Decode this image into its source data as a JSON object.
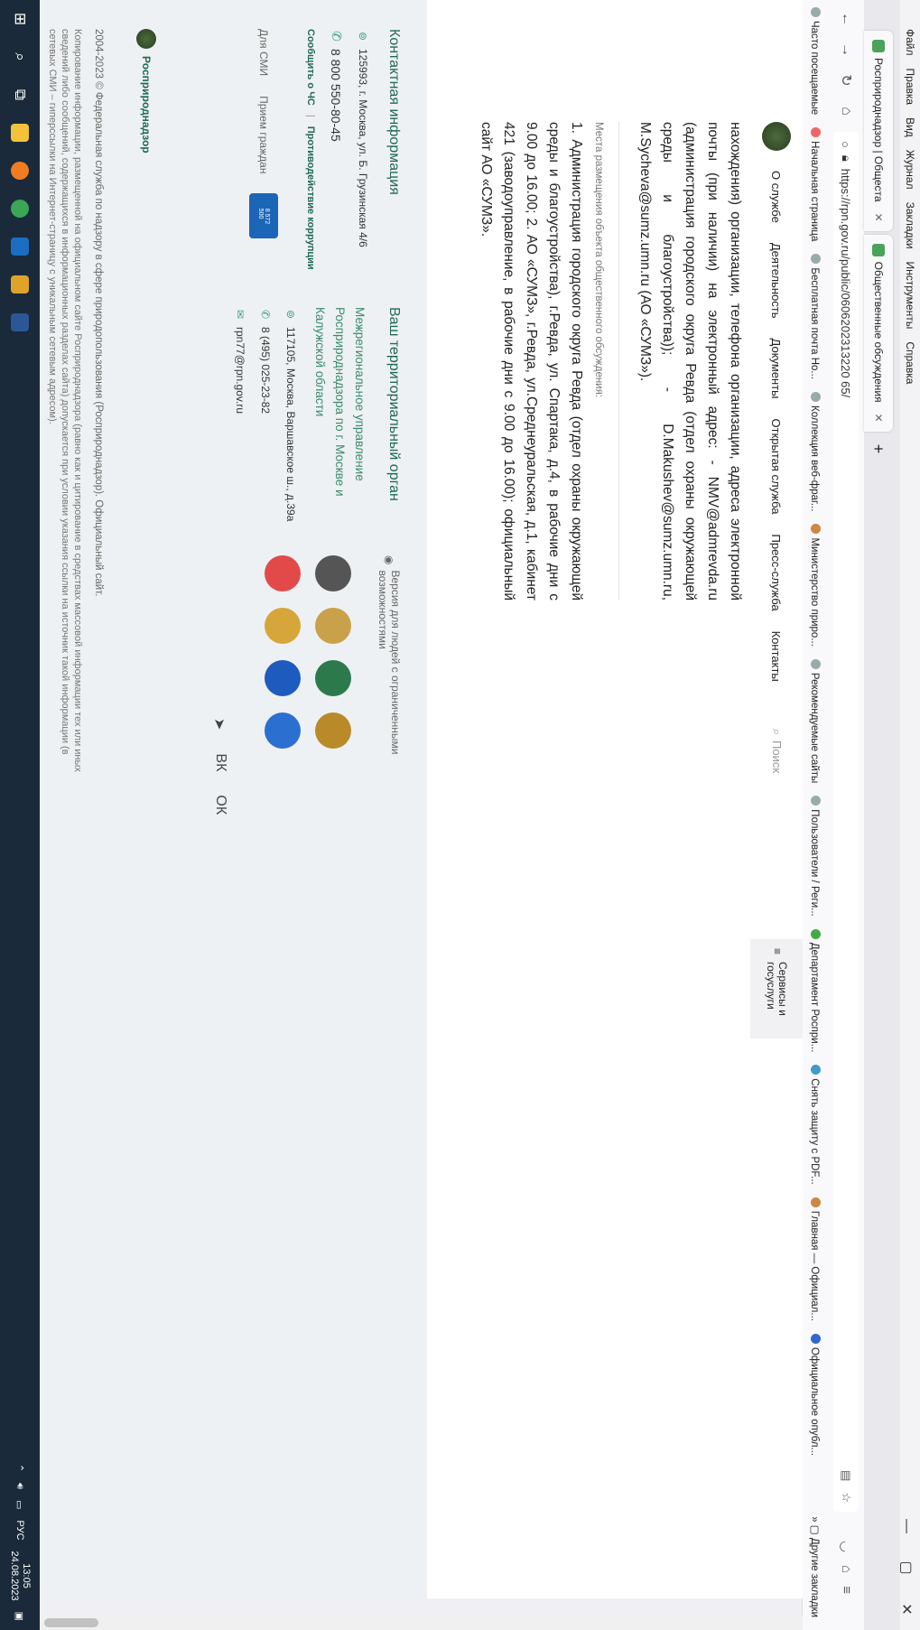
{
  "browser": {
    "menu": [
      "Файл",
      "Правка",
      "Вид",
      "Журнал",
      "Закладки",
      "Инструменты",
      "Справка"
    ],
    "tabs": [
      {
        "label": "Росприроднадзор | Общеста"
      },
      {
        "label": "Общественные обсуждения"
      }
    ],
    "url": "https://rpn.gov.ru/public/0606202313220 65/",
    "bookmarks": [
      "Часто посещаемые",
      "Начальная страница",
      "Бесплатная почта Но...",
      "Коллекция веб-фраг...",
      "Министерство приро...",
      "Рекомендуемые сайты",
      "Пользователи / Реги...",
      "Департамент Роспри...",
      "Снять защиту с PDF...",
      "Главная — Официал...",
      "Официальное опубл..."
    ],
    "bookmarks_more": "Другие закладки"
  },
  "site_nav": {
    "items": [
      "О службе",
      "Деятельность",
      "Документы",
      "Открытая служба",
      "Пресс-служба",
      "Контакты"
    ],
    "search_placeholder": "Поиск",
    "services": "Сервисы и госуслуги"
  },
  "content": {
    "paragraph1": "нахождения) организации, телефона организации, адреса электронной почты (при наличии) на электронный адрес: - NMV@admrevda.ru (администрация городского округа Ревда (отдел охраны окружающей среды и благоустройства)); - D.Makushev@sumz.umn.ru, M.Sycheva@sumz.umn.ru (АО «СУМЗ»).",
    "places_label": "Места размещения объекта общественного обсуждения:",
    "paragraph2": "1. Администрация городского округа Ревда (отдел охраны окружающей среды и благоустройства), г.Ревда, ул. Спартака, д.4, в рабочие дни с 9.00 до 16.00; 2. АО «СУМЗ», г.Ревда, ул.Среднеуральская, д.1, кабинет 421 (заводоуправление, в рабочие дни с 9.00 до 16.00); официальный сайт АО «СУМЗ»."
  },
  "footer": {
    "contacts_title": "Контактная информация",
    "address": "125993, г. Москва, ул. Б. Грузинская 4/6",
    "phone": "8 800 550-80-45",
    "link_emergency": "Сообщить о ЧС",
    "link_corruption": "Противодействие коррупции",
    "media": "Для СМИ",
    "reception": "Прием граждан",
    "territorial_title": "Ваш территориальный орган",
    "territorial_name": "Межрегиональное управление Росприроднадзора по г. Москве и Калужской области",
    "terr_address": "117105, Москва, Варшавское ш., д.39а",
    "terr_phone": "8 (495) 025-23-82",
    "terr_email": "rpn77@rpn.gov.ru",
    "accessibility": "Версия для людей с ограниченными возможностями",
    "brand": "Росприроднадзор",
    "copyright": "2004-2023 © Федеральная служба по надзору в сфере природопользования (Росприроднадзор). Официальный сайт.",
    "legal": "Копирование информации, размещенной на официальном сайте Росприроднадзора (равно как и цитирование в средствах массовой информации тех или иных сведений либо сообщений, содержащихся в информационных разделах сайта) допускается при условии указания ссылки на источник такой информации (в сетевых СМИ – гиперссылки на Интернет-страницу с уникальным сетевым адресом)."
  },
  "taskbar": {
    "lang": "РУС",
    "time": "13:05",
    "date": "24.08.2023"
  }
}
